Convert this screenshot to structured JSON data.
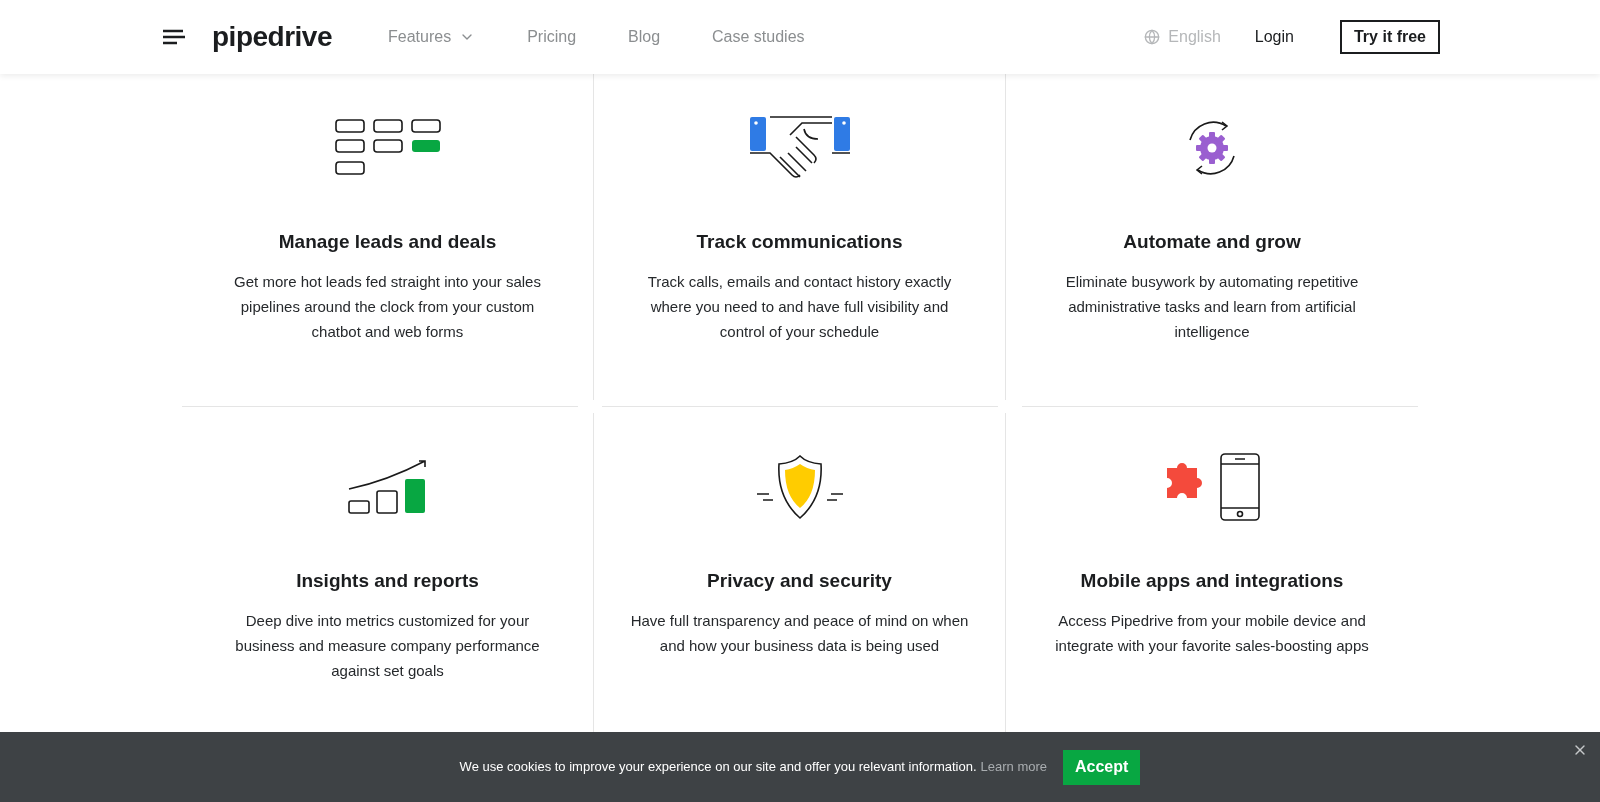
{
  "header": {
    "logo": "pipedrive",
    "nav": [
      {
        "label": "Features",
        "kind": "dropdown"
      },
      {
        "label": "Pricing",
        "kind": "link"
      },
      {
        "label": "Blog",
        "kind": "link"
      },
      {
        "label": "Case studies",
        "kind": "link"
      }
    ],
    "language": "English",
    "login": "Login",
    "cta": "Try it free"
  },
  "features": [
    {
      "kind": "leads",
      "title": "Manage leads and deals",
      "description": "Get more hot leads fed straight into your sales pipelines around the clock from your custom chatbot and web forms"
    },
    {
      "kind": "handshake",
      "title": "Track communications",
      "description": "Track calls, emails and contact history exactly where you need to and have full visibility and control of your schedule"
    },
    {
      "kind": "gear",
      "title": "Automate and grow",
      "description": "Eliminate busywork by automating repetitive administrative tasks and learn from artificial intelligence"
    },
    {
      "kind": "chart",
      "title": "Insights and reports",
      "description": "Deep dive into metrics customized for your business and measure company performance against set goals"
    },
    {
      "kind": "shield",
      "title": "Privacy and security",
      "description": "Have full transparency and peace of mind on when and how your business data is being used"
    },
    {
      "kind": "mobile",
      "title": "Mobile apps and integrations",
      "description": "Access Pipedrive from your mobile device and integrate with your favorite sales-boosting apps"
    }
  ],
  "cookie": {
    "text": "We use cookies to improve your experience on our site and offer you relevant information.",
    "link": "Learn more",
    "button": "Accept"
  }
}
